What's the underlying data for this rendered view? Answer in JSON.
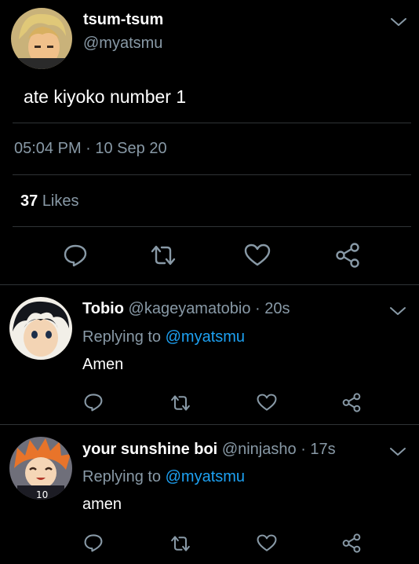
{
  "tweet": {
    "display_name": "tsum-tsum",
    "handle": "@myatsmu",
    "text": "ate kiyoko number 1",
    "timestamp": "05:04 PM · 10 Sep 20",
    "likes_count": "37",
    "likes_label": "Likes"
  },
  "replies": [
    {
      "display_name": "Tobio",
      "handle": "@kageyamatobio",
      "time": "· 20s",
      "replying_prefix": "Replying to",
      "replying_handle": "@myatsmu",
      "text": "Amen"
    },
    {
      "display_name": "your sunshine boi",
      "handle": "@ninjasho",
      "time": "· 17s",
      "replying_prefix": "Replying to",
      "replying_handle": "@myatsmu",
      "text": "amen"
    }
  ],
  "icons": {
    "more": "chevron-down-icon",
    "reply": "reply-icon",
    "retweet": "retweet-icon",
    "like": "heart-icon",
    "share": "share-icon"
  },
  "colors": {
    "background": "#000000",
    "muted": "#8899a6",
    "accent": "#1da1f2",
    "divider": "#2f3336"
  }
}
